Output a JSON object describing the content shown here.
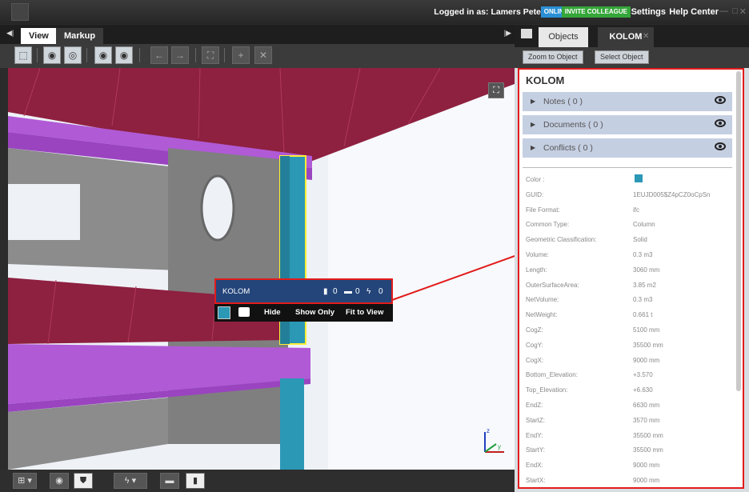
{
  "titlebar": {
    "login_text": "Logged in as: Lamers Peter",
    "online_badge": "ONLINE",
    "invite_badge": "INVITE COLLEAGUE",
    "settings": "Settings",
    "help": "Help Center"
  },
  "left_tabs": {
    "view": "View",
    "markup": "Markup"
  },
  "tooltip": {
    "name": "KOLOM",
    "documents_count": "0",
    "comments_count": "0",
    "conflicts_count": "0",
    "actions": {
      "hide": "Hide",
      "show_only": "Show Only",
      "fit_to_view": "Fit to View"
    }
  },
  "right_panel": {
    "tabs": {
      "objects": "Objects",
      "kolom": "KOLOM"
    },
    "buttons": {
      "zoom": "Zoom to Object",
      "select": "Select Object"
    },
    "title": "KOLOM",
    "sections": [
      {
        "label": "Notes ( 0 )"
      },
      {
        "label": "Documents ( 0 )"
      },
      {
        "label": "Conflicts ( 0 )"
      }
    ],
    "properties": [
      {
        "name": "Color :",
        "value": ""
      },
      {
        "name": "GUID:",
        "value": "1EUJD005$Z4pCZ0oCpSn"
      },
      {
        "name": "File Format:",
        "value": "ifc"
      },
      {
        "name": "Common Type:",
        "value": "Column"
      },
      {
        "name": "Geometric Classification:",
        "value": "Solid"
      },
      {
        "name": "Volume:",
        "value": "0.3 m3"
      },
      {
        "name": "Length:",
        "value": "3060 mm"
      },
      {
        "name": "OuterSurfaceArea:",
        "value": "3.85 m2"
      },
      {
        "name": "NetVolume:",
        "value": "0.3 m3"
      },
      {
        "name": "NetWeight:",
        "value": "0.661 t"
      },
      {
        "name": "CogZ:",
        "value": "5100 mm"
      },
      {
        "name": "CogY:",
        "value": "35500 mm"
      },
      {
        "name": "CogX:",
        "value": "9000 mm"
      },
      {
        "name": "Bottom_Elevation:",
        "value": "+3.570"
      },
      {
        "name": "Top_Elevation:",
        "value": "+6.630"
      },
      {
        "name": "EndZ:",
        "value": "6630 mm"
      },
      {
        "name": "StartZ:",
        "value": "3570 mm"
      },
      {
        "name": "EndY:",
        "value": "35500 mm"
      },
      {
        "name": "StartY:",
        "value": "35500 mm"
      },
      {
        "name": "EndX:",
        "value": "9000 mm"
      },
      {
        "name": "StartX:",
        "value": "9000 mm"
      }
    ]
  },
  "colors": {
    "beam": "#b05ad6",
    "slab": "#8e2040",
    "wall": "#8c8c8c",
    "column": "#2b98b6",
    "highlight": "#e21b1b"
  }
}
